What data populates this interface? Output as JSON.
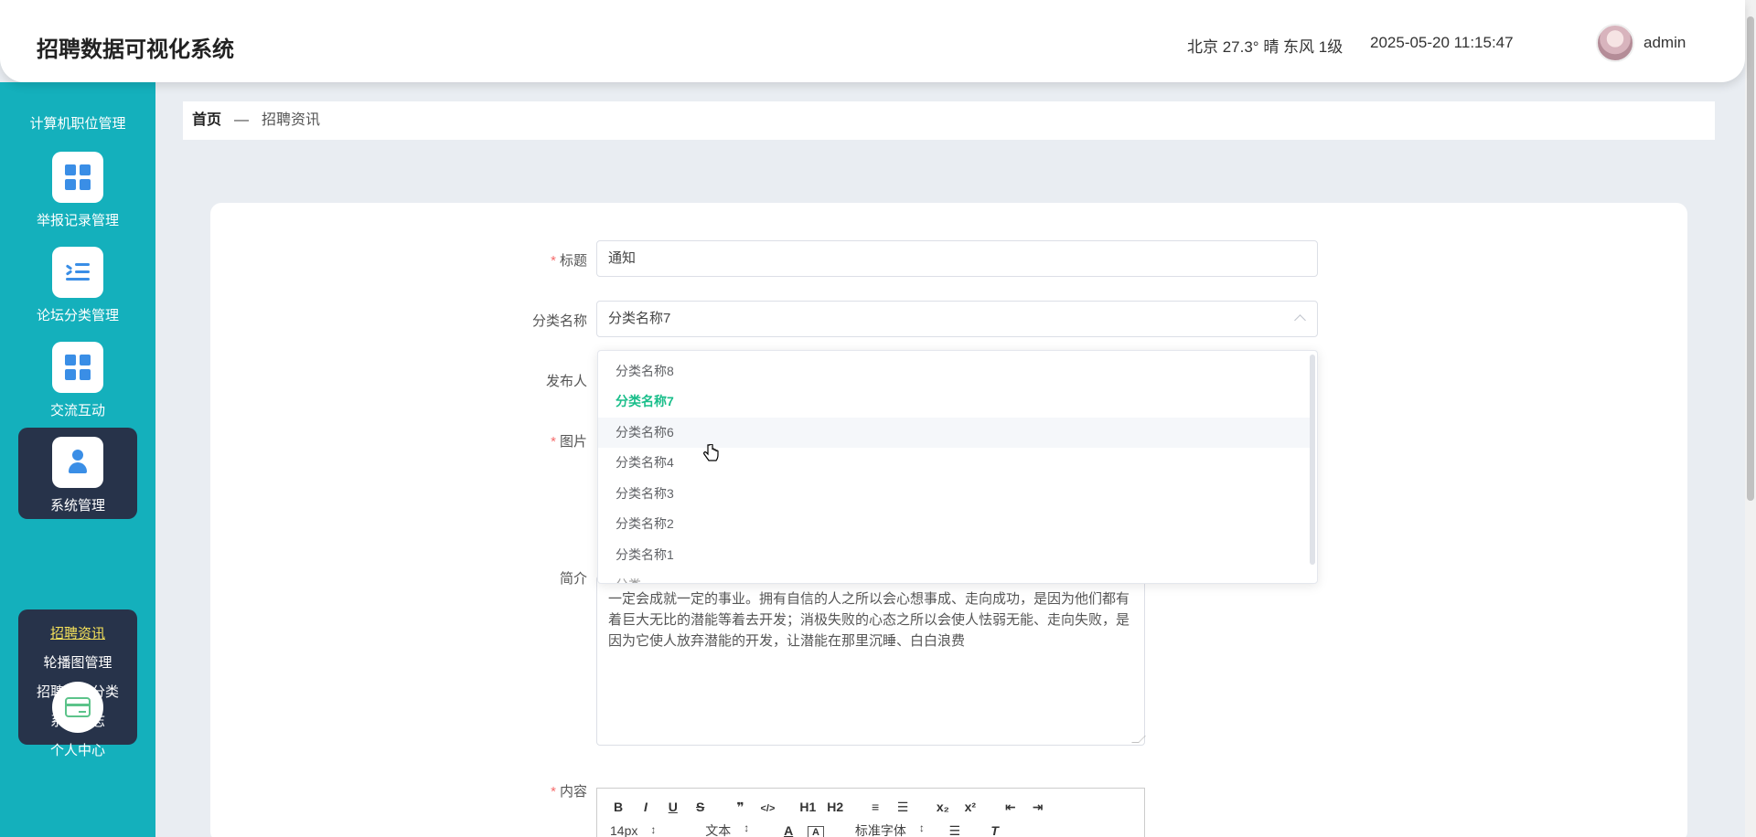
{
  "header": {
    "app_title": "招聘数据可视化系统",
    "weather": "北京  27.3°  晴  东风  1级",
    "datetime": "2025-05-20 11:15:47",
    "username": "admin"
  },
  "sidebar": {
    "top_label": "计算机职位管理",
    "items": [
      {
        "label": "举报记录管理",
        "icon": "grid-icon"
      },
      {
        "label": "论坛分类管理",
        "icon": "list-indent-icon"
      },
      {
        "label": "交流互动",
        "icon": "grid-icon"
      },
      {
        "label": "系统管理",
        "icon": "person-icon",
        "active": true
      },
      {
        "label": "个人中心",
        "icon": "wallet-icon"
      }
    ],
    "submenu": [
      "招聘资讯",
      "轮播图管理",
      "招聘资讯分类",
      "系统日志"
    ]
  },
  "breadcrumb": {
    "home": "首页",
    "separator": "—",
    "current": "招聘资讯"
  },
  "form": {
    "title_label": "标题",
    "title_value": "通知",
    "category_label": "分类名称",
    "category_value": "分类名称7",
    "publisher_label": "发布人",
    "image_label": "图片",
    "intro_label": "简介",
    "intro_value": "一定会成就一定的事业。拥有自信的人之所以会心想事成、走向成功，是因为他们都有着巨大无比的潜能等着去开发；消极失败的心态之所以会使人怯弱无能、走向失败，是因为它使人放弃潜能的开发，让潜能在那里沉睡、白白浪费",
    "content_label": "内容",
    "required_mark": "*"
  },
  "dropdown": {
    "options": [
      "分类名称8",
      "分类名称7",
      "分类名称6",
      "分类名称4",
      "分类名称3",
      "分类名称2",
      "分类名称1",
      "分类"
    ],
    "selected": "分类名称7",
    "hovered": "分类名称6"
  },
  "editor_toolbar": {
    "row1": [
      "B",
      "I",
      "U",
      "S",
      "❞",
      "</>",
      "H1",
      "H2",
      "≡",
      "☰",
      "x₂",
      "x²",
      "⇤",
      "⇥"
    ],
    "font_size": "14px",
    "block_type": "文本",
    "font_family": "标准字体"
  },
  "colors": {
    "sidebar_bg": "#14b0bc",
    "active_bg": "#27334a",
    "icon_blue": "#3a8ee6",
    "selected_green": "#19be8a",
    "required_red": "#f56c6c",
    "submenu_current": "#f5e15a"
  }
}
